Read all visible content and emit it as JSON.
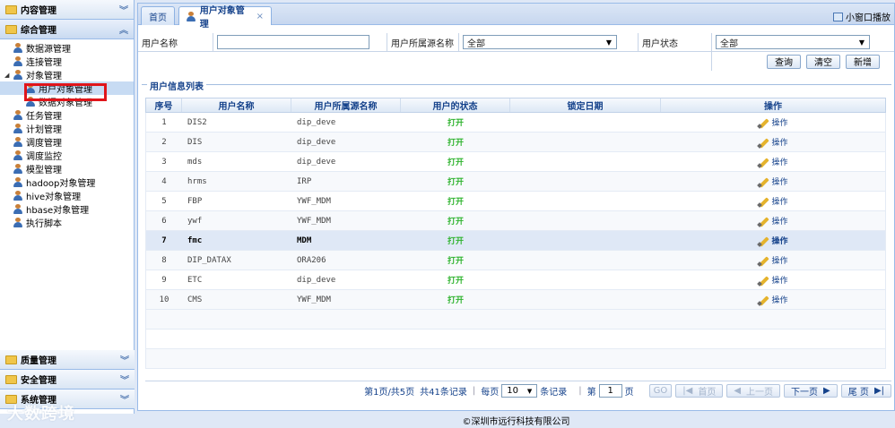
{
  "sidebar": {
    "top_header": "内容管理",
    "active_header": "综合管理",
    "tree": [
      {
        "label": "数据源管理",
        "level": 1
      },
      {
        "label": "连接管理",
        "level": 1
      },
      {
        "label": "对象管理",
        "level": 1,
        "expanded": true
      },
      {
        "label": "用户对象管理",
        "level": 2,
        "selected": true
      },
      {
        "label": "数据对象管理",
        "level": 2
      },
      {
        "label": "任务管理",
        "level": 1
      },
      {
        "label": "计划管理",
        "level": 1
      },
      {
        "label": "调度管理",
        "level": 1
      },
      {
        "label": "调度监控",
        "level": 1
      },
      {
        "label": "模型管理",
        "level": 1
      },
      {
        "label": "hadoop对象管理",
        "level": 1
      },
      {
        "label": "hive对象管理",
        "level": 1
      },
      {
        "label": "hbase对象管理",
        "level": 1
      },
      {
        "label": "执行脚本",
        "level": 1
      }
    ],
    "bottom_headers": [
      "质量管理",
      "安全管理",
      "系统管理"
    ]
  },
  "tabs": {
    "home": "首页",
    "current": "用户对象管理",
    "close": "×",
    "small_window": "小窗口播放"
  },
  "form": {
    "username_label": "用户名称",
    "username_value": "",
    "source_label": "用户所属源名称",
    "source_value": "全部",
    "status_label": "用户状态",
    "status_value": "全部",
    "query_btn": "查询",
    "clear_btn": "清空",
    "add_btn": "新增"
  },
  "list": {
    "legend": "用户信息列表",
    "columns": [
      "序号",
      "用户名称",
      "用户所属源名称",
      "用户的状态",
      "锁定日期",
      "操作"
    ],
    "rows": [
      {
        "no": "1",
        "name": "DIS2",
        "source": "dip_deve",
        "status": "打开",
        "date": "",
        "op": "操作"
      },
      {
        "no": "2",
        "name": "DIS",
        "source": "dip_deve",
        "status": "打开",
        "date": "",
        "op": "操作"
      },
      {
        "no": "3",
        "name": "mds",
        "source": "dip_deve",
        "status": "打开",
        "date": "",
        "op": "操作"
      },
      {
        "no": "4",
        "name": "hrms",
        "source": "IRP",
        "status": "打开",
        "date": "",
        "op": "操作"
      },
      {
        "no": "5",
        "name": "FBP",
        "source": "YWF_MDM",
        "status": "打开",
        "date": "",
        "op": "操作"
      },
      {
        "no": "6",
        "name": "ywf",
        "source": "YWF_MDM",
        "status": "打开",
        "date": "",
        "op": "操作"
      },
      {
        "no": "7",
        "name": "fmc",
        "source": "MDM",
        "status": "打开",
        "date": "",
        "op": "操作"
      },
      {
        "no": "8",
        "name": "DIP_DATAX",
        "source": "ORA206",
        "status": "打开",
        "date": "",
        "op": "操作"
      },
      {
        "no": "9",
        "name": "ETC",
        "source": "dip_deve",
        "status": "打开",
        "date": "",
        "op": "操作"
      },
      {
        "no": "10",
        "name": "CMS",
        "source": "YWF_MDM",
        "status": "打开",
        "date": "",
        "op": "操作"
      }
    ],
    "selected_row": 6
  },
  "pager": {
    "summary": "第1页/共5页",
    "total": "共41条记录",
    "per_page_label": "每页",
    "per_page_value": "10",
    "per_page_unit": "条记录",
    "goto_label": "第",
    "goto_value": "1",
    "goto_unit": "页",
    "go": "GO",
    "first": "首页",
    "prev": "上一页",
    "next": "下一页",
    "last": "尾 页"
  },
  "footer": "©深圳市远行科技有限公司",
  "watermark": "大数跨境"
}
